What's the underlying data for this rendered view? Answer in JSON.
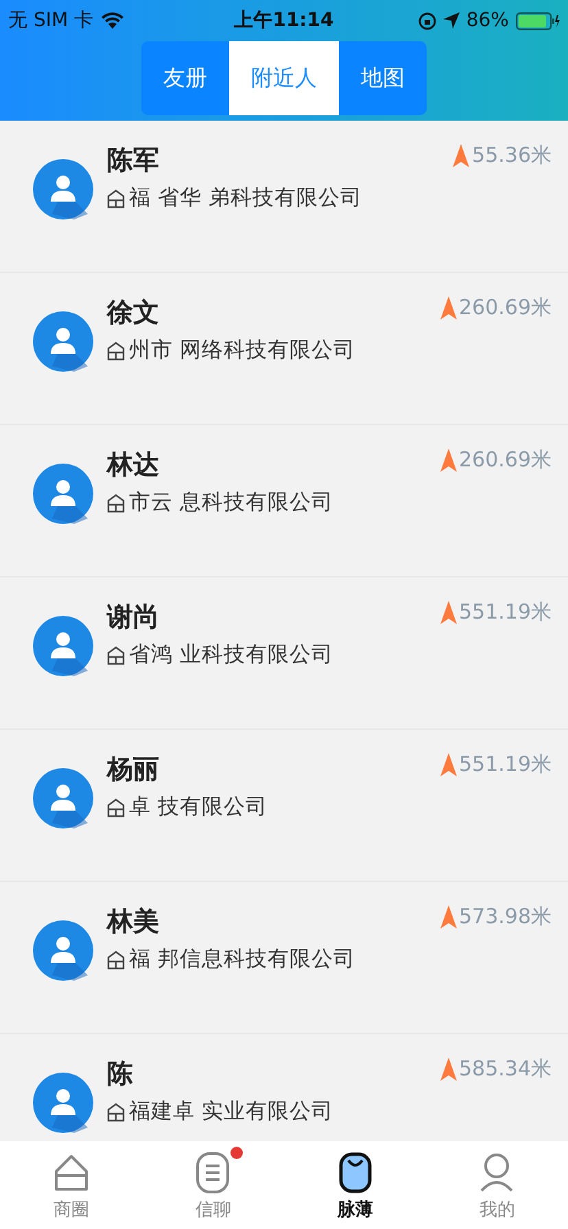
{
  "status_bar": {
    "carrier": "无 SIM 卡",
    "time": "上午11:14",
    "battery": "86%"
  },
  "tabs": [
    {
      "label": "友册",
      "selected": false
    },
    {
      "label": "附近人",
      "selected": true
    },
    {
      "label": "地图",
      "selected": false
    }
  ],
  "people": [
    {
      "name": "陈军",
      "company": "福  省华  弟科技有限公司",
      "distance": "55.36米"
    },
    {
      "name": "徐文",
      "company": "州市  网络科技有限公司",
      "distance": "260.69米"
    },
    {
      "name": "林达",
      "company": "市云  息科技有限公司",
      "distance": "260.69米"
    },
    {
      "name": "谢尚",
      "company": "省鸿  业科技有限公司",
      "distance": "551.19米"
    },
    {
      "name": "杨丽",
      "company": "卓  技有限公司",
      "distance": "551.19米"
    },
    {
      "name": "林美",
      "company": "福  邦信息科技有限公司",
      "distance": "573.98米"
    },
    {
      "name": "陈",
      "company": "福建卓  实业有限公司",
      "distance": "585.34米"
    }
  ],
  "bottom_nav": [
    {
      "label": "商圈",
      "kind": "home",
      "selected": false,
      "badge": false
    },
    {
      "label": "信聊",
      "kind": "chat",
      "selected": false,
      "badge": true
    },
    {
      "label": "脉薄",
      "kind": "contacts",
      "selected": true,
      "badge": false
    },
    {
      "label": "我的",
      "kind": "profile",
      "selected": false,
      "badge": false
    }
  ]
}
